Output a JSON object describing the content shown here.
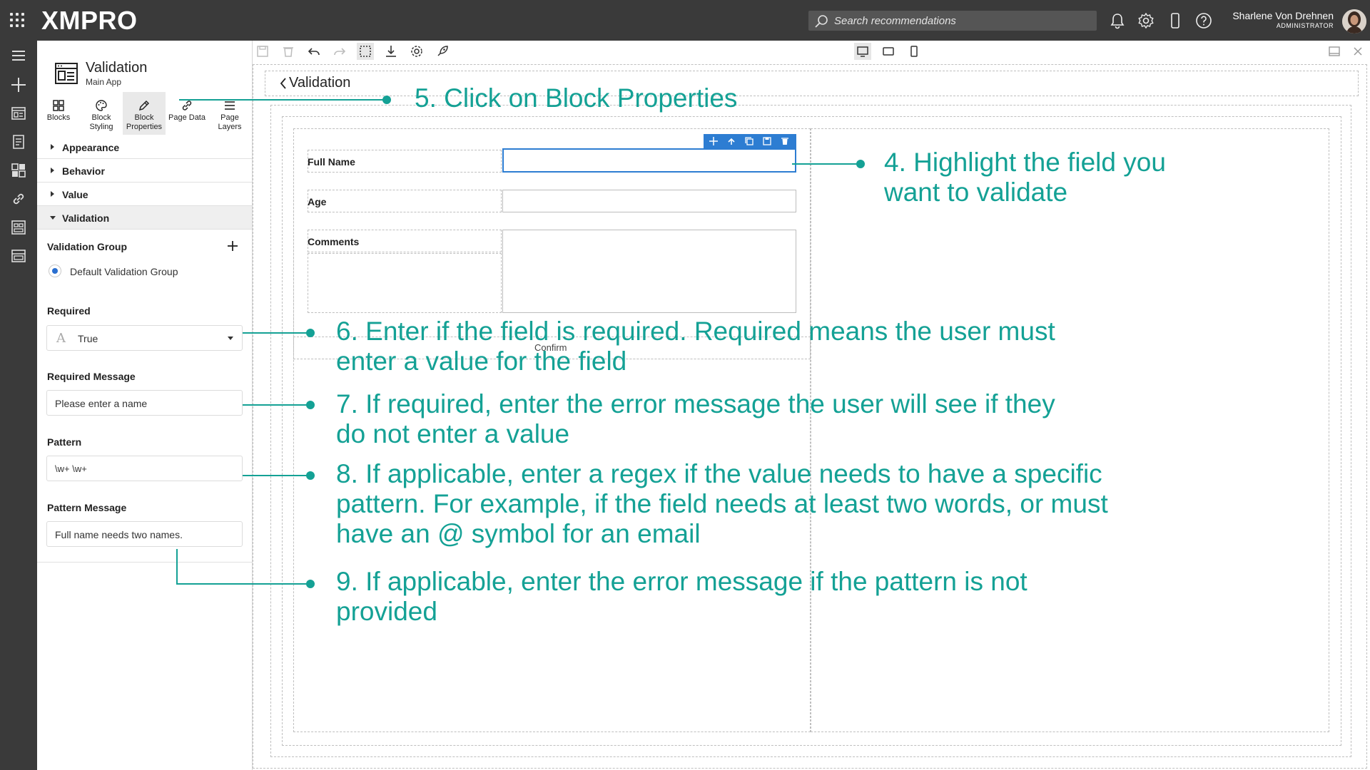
{
  "topbar": {
    "logo": "XMPRO",
    "search_placeholder": "Search recommendations",
    "user_name": "Sharlene Von Drehnen",
    "user_role": "ADMINISTRATOR"
  },
  "panel": {
    "title": "Validation",
    "subtitle": "Main App",
    "tabs": [
      {
        "label_line1": "Blocks",
        "label_line2": "",
        "icon": "blocks-grid-icon"
      },
      {
        "label_line1": "Block",
        "label_line2": "Styling",
        "icon": "palette-icon"
      },
      {
        "label_line1": "Block",
        "label_line2": "Properties",
        "icon": "pencil-icon"
      },
      {
        "label_line1": "Page Data",
        "label_line2": "",
        "icon": "link-icon"
      },
      {
        "label_line1": "Page",
        "label_line2": "Layers",
        "icon": "layers-icon"
      }
    ],
    "sections": [
      "Appearance",
      "Behavior",
      "Value",
      "Validation"
    ],
    "validation_group_label": "Validation Group",
    "default_group_label": "Default Validation Group",
    "required_label": "Required",
    "required_value": "True",
    "required_message_label": "Required Message",
    "required_message_value": "Please enter a name",
    "pattern_label": "Pattern",
    "pattern_value": "\\w+ \\w+",
    "pattern_message_label": "Pattern Message",
    "pattern_message_value": "Full name needs two names."
  },
  "canvas": {
    "page_title": "Validation",
    "fields": [
      "Full Name",
      "Age",
      "Comments"
    ],
    "confirm_label": "Confirm"
  },
  "annotations": {
    "a5": "5. Click on Block Properties",
    "a4_line1": "4. Highlight the field you",
    "a4_line2": "want to validate",
    "a6_line1": "6. Enter if the field is required. Required means the user must",
    "a6_line2": "enter a value for the field",
    "a7_line1": "7. If required, enter the error message the user will see if they",
    "a7_line2": "do not enter a value",
    "a8_line1": "8. If applicable, enter a regex if the value needs to have a specific",
    "a8_line2": "pattern. For example, if the field needs at least two words, or must",
    "a8_line3": "have an @ symbol for an email",
    "a9_line1": "9. If applicable, enter the error message if the pattern is not",
    "a9_line2": "provided"
  },
  "colors": {
    "topbar": "#3a3a3a",
    "accent_teal": "#14a195",
    "selection_blue": "#2d7dd2"
  }
}
